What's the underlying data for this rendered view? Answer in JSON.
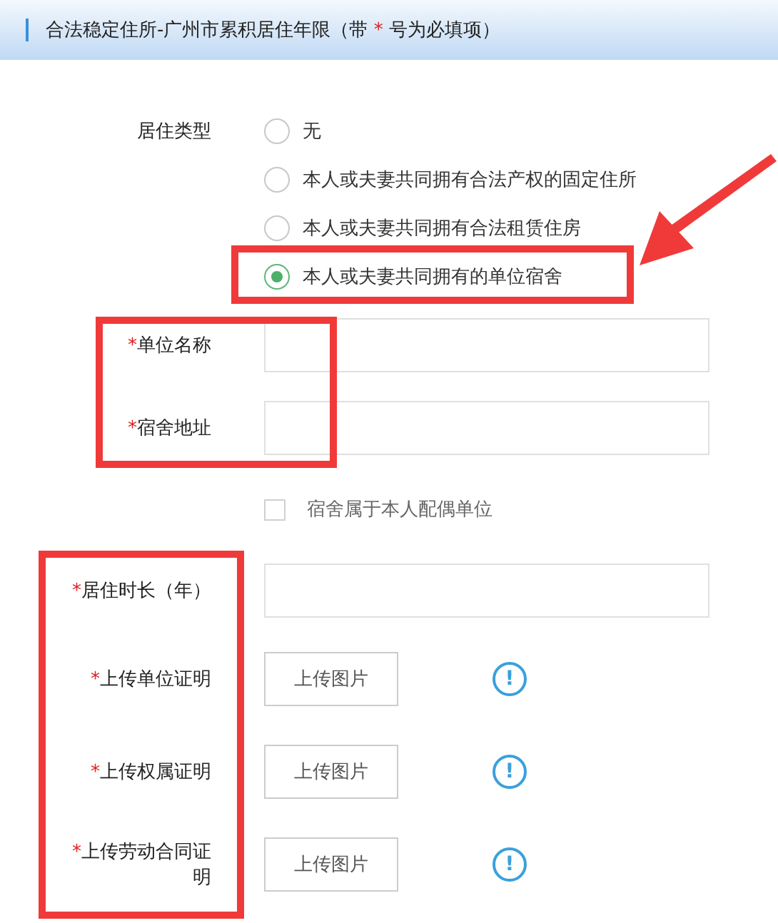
{
  "header": {
    "title_before": "合法稳定住所-广州市累积居住年限（带",
    "required_mark": "*",
    "title_after": "号为必填项）"
  },
  "residence_type": {
    "label": "居住类型",
    "options": [
      {
        "label": "无",
        "selected": false
      },
      {
        "label": "本人或夫妻共同拥有合法产权的固定住所",
        "selected": false
      },
      {
        "label": "本人或夫妻共同拥有合法租赁住房",
        "selected": false
      },
      {
        "label": "本人或夫妻共同拥有的单位宿舍",
        "selected": true
      }
    ]
  },
  "fields": [
    {
      "kind": "text",
      "required_mark": "*",
      "label": "单位名称"
    },
    {
      "kind": "text",
      "required_mark": "*",
      "label": "宿舍地址"
    },
    {
      "kind": "checkbox",
      "label": "宿舍属于本人配偶单位",
      "checked": false
    },
    {
      "kind": "text",
      "required_mark": "*",
      "label": "居住时长（年）"
    },
    {
      "kind": "upload",
      "required_mark": "*",
      "label": "上传单位证明",
      "button": "上传图片",
      "info": "!"
    },
    {
      "kind": "upload",
      "required_mark": "*",
      "label": "上传权属证明",
      "button": "上传图片",
      "info": "!"
    },
    {
      "kind": "upload",
      "required_mark": "*",
      "label": "上传劳动合同证明",
      "button": "上传图片",
      "info": "!"
    }
  ]
}
